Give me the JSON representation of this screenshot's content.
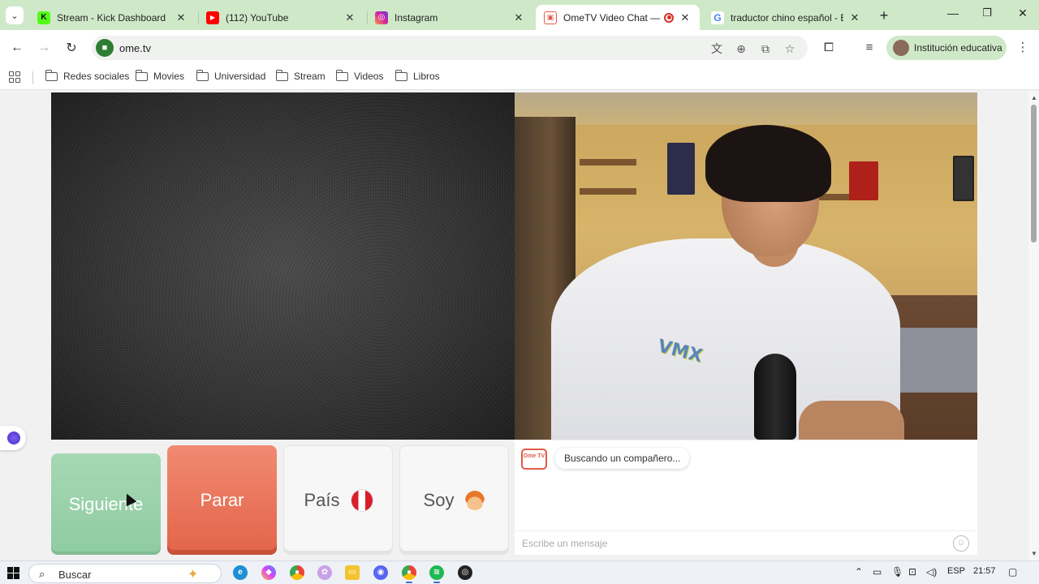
{
  "tabs": [
    {
      "title": "Stream - Kick Dashboard",
      "favicon": "kick-icon",
      "color": "#53fc18",
      "glyph": "K"
    },
    {
      "title": "(112) YouTube",
      "favicon": "youtube-icon",
      "color": "#ff0000",
      "glyph": "▶"
    },
    {
      "title": "Instagram",
      "favicon": "instagram-icon",
      "color": "#d6249f",
      "glyph": "◎"
    },
    {
      "title": "OmeTV Video Chat — C",
      "favicon": "ometv-icon",
      "color": "#e35b48",
      "glyph": "▣",
      "active": true
    },
    {
      "title": "traductor chino español - Bu",
      "favicon": "google-icon",
      "color": "#4285f4",
      "glyph": "G"
    }
  ],
  "toolbar": {
    "url": "ome.tv",
    "profile_label": "Institución educativa"
  },
  "bookmarks": [
    "Redes sociales",
    "Movies",
    "Universidad",
    "Stream",
    "Videos",
    "Libros"
  ],
  "controls": {
    "next_label": "Siguiente",
    "stop_label": "Parar",
    "country_label": "País",
    "gender_label": "Soy"
  },
  "chat": {
    "status_message": "Buscando un compañero...",
    "input_placeholder": "Escribe un mensaje",
    "logo_text": "Ome TV"
  },
  "taskbar": {
    "search_label": "Buscar",
    "language": "ESP",
    "time": "21:57"
  },
  "colors": {
    "next_button": "#8fcca1",
    "stop_button": "#e3644a",
    "tab_strip": "#cfe9c8"
  }
}
